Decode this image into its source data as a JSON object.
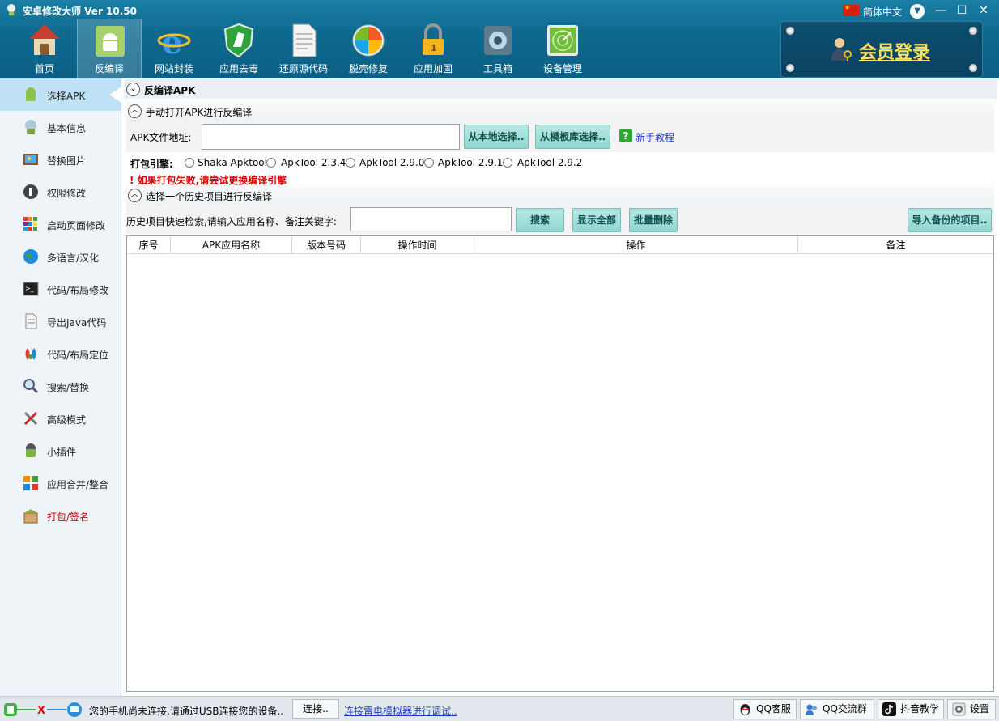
{
  "window": {
    "title": "安卓修改大师 Ver 10.50",
    "language": "简体中文"
  },
  "toolbar": {
    "items": [
      {
        "label": "首页",
        "icon": "house-icon"
      },
      {
        "label": "反编译",
        "icon": "android-robot-icon"
      },
      {
        "label": "网站封装",
        "icon": "ie-browser-icon"
      },
      {
        "label": "应用去毒",
        "icon": "shield-horse-icon"
      },
      {
        "label": "还原源代码",
        "icon": "document-icon"
      },
      {
        "label": "脱壳修复",
        "icon": "windows-ball-icon"
      },
      {
        "label": "应用加固",
        "icon": "padlock-icon"
      },
      {
        "label": "工具箱",
        "icon": "toolbox-icon"
      },
      {
        "label": "设备管理",
        "icon": "radar-icon"
      }
    ],
    "active_index": 1
  },
  "member": {
    "login_label": "会员登录"
  },
  "sidebar": {
    "items": [
      {
        "label": "选择APK",
        "icon": "android-icon"
      },
      {
        "label": "基本信息",
        "icon": "robot-info-icon"
      },
      {
        "label": "替换图片",
        "icon": "picture-icon"
      },
      {
        "label": "权限修改",
        "icon": "permission-icon"
      },
      {
        "label": "启动页面修改",
        "icon": "launch-tiles-icon"
      },
      {
        "label": "多语言/汉化",
        "icon": "globe-icon"
      },
      {
        "label": "代码/布局修改",
        "icon": "terminal-icon"
      },
      {
        "label": "导出Java代码",
        "icon": "export-document-icon"
      },
      {
        "label": "代码/布局定位",
        "icon": "map-pin-icon"
      },
      {
        "label": "搜索/替换",
        "icon": "magnifier-icon"
      },
      {
        "label": "高级模式",
        "icon": "tools-icon"
      },
      {
        "label": "小插件",
        "icon": "android-plugin-icon"
      },
      {
        "label": "应用合并/整合",
        "icon": "merge-tiles-icon"
      },
      {
        "label": "打包/签名",
        "icon": "package-icon"
      }
    ],
    "active_index": 0
  },
  "main": {
    "section_title": "反编译APK",
    "manual_section": {
      "title": "手动打开APK进行反编译",
      "file_label": "APK文件地址:",
      "file_value": "",
      "local_btn": "从本地选择..",
      "template_btn": "从模板库选择..",
      "tutorial_link": "新手教程"
    },
    "engine": {
      "label": "打包引擎:",
      "options": [
        "Shaka Apktool",
        "ApkTool 2.3.4",
        "ApkTool 2.9.0",
        "ApkTool 2.9.1",
        "ApkTool 2.9.2"
      ],
      "warning": "! 如果打包失败,请尝试更换编译引擎"
    },
    "history_section": {
      "title": "选择一个历史项目进行反编译",
      "search_label": "历史项目快速检索,请输入应用名称、备注关键字:",
      "search_value": "",
      "search_btn": "搜索",
      "show_all_btn": "显示全部",
      "batch_delete_btn": "批量删除",
      "import_btn": "导入备份的项目.."
    },
    "table": {
      "columns": [
        "序号",
        "APK应用名称",
        "版本号码",
        "操作时间",
        "操作",
        "备注"
      ],
      "rows": []
    }
  },
  "status": {
    "connection_text": "您的手机尚未连接,请通过USB连接您的设备..",
    "connect_btn": "连接..",
    "emulator_link": "连接雷电模拟器进行调试..",
    "buttons": [
      {
        "label": "QQ客服",
        "icon": "qq-penguin-icon"
      },
      {
        "label": "QQ交流群",
        "icon": "qq-group-icon"
      },
      {
        "label": "抖音教学",
        "icon": "douyin-icon"
      },
      {
        "label": "设置",
        "icon": "settings-icon"
      }
    ]
  }
}
